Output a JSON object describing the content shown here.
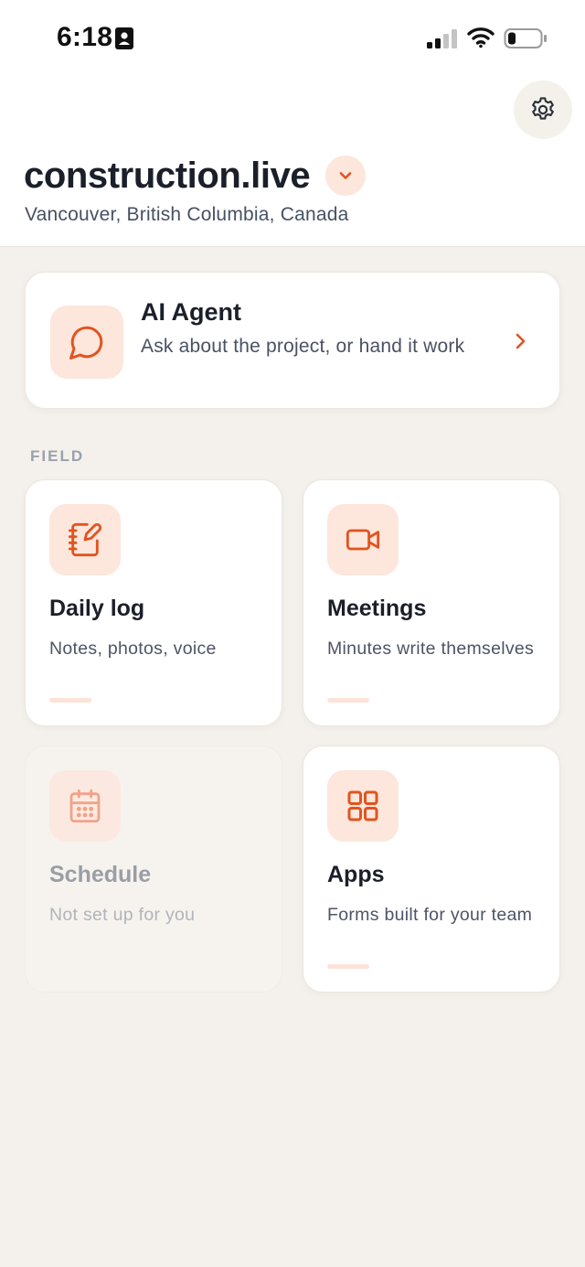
{
  "status_bar": {
    "time": "6:18",
    "icons": [
      "id-card-icon",
      "cellular-signal-icon",
      "wifi-icon",
      "battery-icon"
    ]
  },
  "header": {
    "project_name": "construction.live",
    "location": "Vancouver, British Columbia, Canada",
    "icons": [
      "gear-icon",
      "chevron-down-icon"
    ]
  },
  "agent": {
    "title": "AI Agent",
    "description": "Ask about the project, or hand it work",
    "icons": [
      "chat-bubble-icon",
      "chevron-right-icon"
    ]
  },
  "section": {
    "label": "FIELD"
  },
  "tiles": [
    {
      "title": "Daily log",
      "description": "Notes, photos, voice",
      "icon": "notebook-pencil-icon",
      "enabled": true
    },
    {
      "title": "Meetings",
      "description": "Minutes write themselves",
      "icon": "video-camera-icon",
      "enabled": true
    },
    {
      "title": "Schedule",
      "description": "Not set up for you",
      "icon": "calendar-icon",
      "enabled": false
    },
    {
      "title": "Apps",
      "description": "Forms built for your team",
      "icon": "grid-icon",
      "enabled": true
    }
  ],
  "colors": {
    "accent": "#e0541f",
    "accent_soft": "#fde6dc",
    "background": "#f4f1ec",
    "card": "#ffffff",
    "text_primary": "#1b1f2a",
    "text_secondary": "#4a5163",
    "muted_label": "#9aa0ab"
  }
}
